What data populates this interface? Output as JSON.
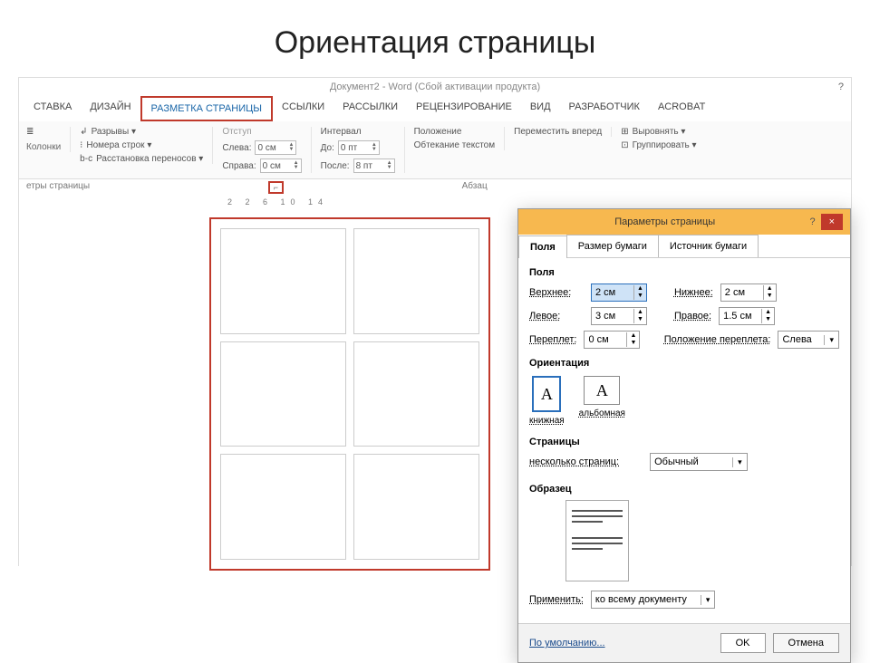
{
  "slide_title": "Ориентация страницы",
  "window": {
    "title": "Документ2 - Word (Сбой активации продукта)",
    "help": "?"
  },
  "tabs": [
    "СТАВКА",
    "ДИЗАЙН",
    "РАЗМЕТКА СТРАНИЦЫ",
    "ССЫЛКИ",
    "РАССЫЛКИ",
    "РЕЦЕНЗИРОВАНИЕ",
    "ВИД",
    "РАЗРАБОТЧИК",
    "ACROBAT"
  ],
  "active_tab_index": 2,
  "ribbon": {
    "columns_label": "Колонки",
    "breaks": "Разрывы ▾",
    "line_numbers": "Номера строк ▾",
    "hyphenation": "Расстановка переносов ▾",
    "indent_group": "Отступ",
    "interval_group": "Интервал",
    "left_label": "Слева:",
    "right_label": "Справа:",
    "before_label": "До:",
    "after_label": "После:",
    "left_val": "0 см",
    "right_val": "0 см",
    "before_val": "0 пт",
    "after_val": "8 пт",
    "position": "Положение",
    "wrap": "Обтекание текстом",
    "forward": "Переместить вперед",
    "align": "Выровнять ▾",
    "group": "Группировать ▾"
  },
  "group_bar": {
    "left": "етры страницы",
    "launcher": "⌐",
    "mid": "Абзац"
  },
  "ruler": "2 2  6  10 14",
  "dialog": {
    "title": "Параметры страницы",
    "help": "?",
    "close": "×",
    "tabs": [
      "Поля",
      "Размер бумаги",
      "Источник бумаги"
    ],
    "active_tab": 0,
    "section_fields": "Поля",
    "top_label": "Верхнее:",
    "top_val": "2 см",
    "bottom_label": "Нижнее:",
    "bottom_val": "2 см",
    "left_label": "Левое:",
    "left_val": "3 см",
    "right_label": "Правое:",
    "right_val": "1.5 см",
    "gutter_label": "Переплет:",
    "gutter_val": "0 см",
    "gutter_pos_label": "Положение переплета:",
    "gutter_pos_val": "Слева",
    "section_orient": "Ориентация",
    "portrait_label": "книжная",
    "landscape_label": "альбомная",
    "section_pages": "Страницы",
    "multi_label": "несколько страниц:",
    "multi_val": "Обычный",
    "section_sample": "Образец",
    "apply_label": "Применить:",
    "apply_val": "ко всему документу",
    "default_btn": "По умолчанию...",
    "ok": "OK",
    "cancel": "Отмена"
  }
}
